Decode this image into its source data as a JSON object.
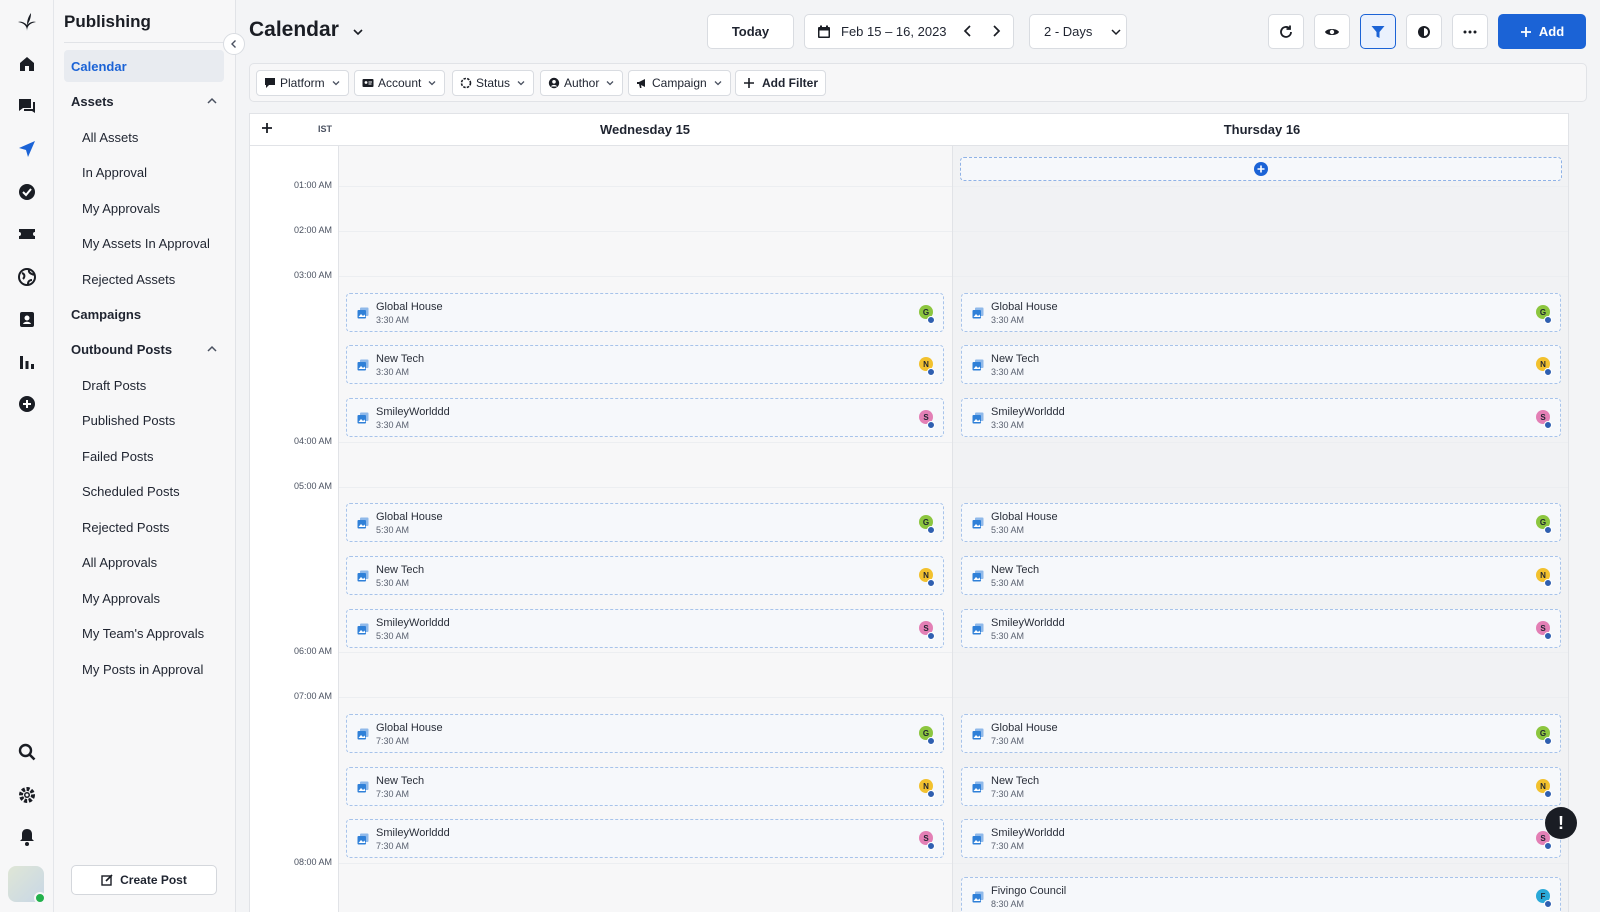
{
  "app": {
    "section_title": "Publishing"
  },
  "sidebar": {
    "items": [
      {
        "label": "Calendar"
      },
      {
        "label": "Assets"
      },
      {
        "label": "All Assets"
      },
      {
        "label": "In Approval"
      },
      {
        "label": "My Approvals"
      },
      {
        "label": "My Assets In Approval"
      },
      {
        "label": "Rejected Assets"
      },
      {
        "label": "Campaigns"
      },
      {
        "label": "Outbound Posts"
      },
      {
        "label": "Draft Posts"
      },
      {
        "label": "Published Posts"
      },
      {
        "label": "Failed Posts"
      },
      {
        "label": "Scheduled Posts"
      },
      {
        "label": "Rejected Posts"
      },
      {
        "label": "All Approvals"
      },
      {
        "label": "My Approvals"
      },
      {
        "label": "My Team's Approvals"
      },
      {
        "label": "My Posts in Approval"
      }
    ],
    "create_post_label": "Create Post"
  },
  "rail_icons": [
    "home-icon",
    "chat-icon",
    "send-icon",
    "check-circle-icon",
    "ticket-icon",
    "globe-icon",
    "contact-icon",
    "bar-chart-icon",
    "plus-circle-icon",
    "search-icon",
    "gear-icon",
    "bell-icon"
  ],
  "header": {
    "title": "Calendar",
    "today_label": "Today",
    "date_range": "Feb 15 – 16, 2023",
    "view_range": "2 - Days",
    "add_label": "Add"
  },
  "filters": {
    "platform": "Platform",
    "account": "Account",
    "status": "Status",
    "author": "Author",
    "campaign": "Campaign",
    "add_filter": "Add Filter"
  },
  "calendar": {
    "timezone": "IST",
    "days": [
      "Wednesday 15",
      "Thursday 16"
    ],
    "hours": [
      "01:00 AM",
      "02:00 AM",
      "03:00 AM",
      "04:00 AM",
      "05:00 AM",
      "06:00 AM",
      "07:00 AM",
      "08:00 AM"
    ],
    "events": {
      "wed": [
        {
          "name": "Global House",
          "time": "3:30 AM",
          "initial": "G",
          "color": "#8cc63f"
        },
        {
          "name": "New Tech",
          "time": "3:30 AM",
          "initial": "N",
          "color": "#f2c12e"
        },
        {
          "name": "SmileyWorlddd",
          "time": "3:30 AM",
          "initial": "S",
          "color": "#e37fb5"
        },
        {
          "name": "Global House",
          "time": "5:30 AM",
          "initial": "G",
          "color": "#8cc63f"
        },
        {
          "name": "New Tech",
          "time": "5:30 AM",
          "initial": "N",
          "color": "#f2c12e"
        },
        {
          "name": "SmileyWorlddd",
          "time": "5:30 AM",
          "initial": "S",
          "color": "#e37fb5"
        },
        {
          "name": "Global House",
          "time": "7:30 AM",
          "initial": "G",
          "color": "#8cc63f"
        },
        {
          "name": "New Tech",
          "time": "7:30 AM",
          "initial": "N",
          "color": "#f2c12e"
        },
        {
          "name": "SmileyWorlddd",
          "time": "7:30 AM",
          "initial": "S",
          "color": "#e37fb5"
        }
      ],
      "thu": [
        {
          "name": "Global House",
          "time": "3:30 AM",
          "initial": "G",
          "color": "#8cc63f"
        },
        {
          "name": "New Tech",
          "time": "3:30 AM",
          "initial": "N",
          "color": "#f2c12e"
        },
        {
          "name": "SmileyWorlddd",
          "time": "3:30 AM",
          "initial": "S",
          "color": "#e37fb5"
        },
        {
          "name": "Global House",
          "time": "5:30 AM",
          "initial": "G",
          "color": "#8cc63f"
        },
        {
          "name": "New Tech",
          "time": "5:30 AM",
          "initial": "N",
          "color": "#f2c12e"
        },
        {
          "name": "SmileyWorlddd",
          "time": "5:30 AM",
          "initial": "S",
          "color": "#e37fb5"
        },
        {
          "name": "Global House",
          "time": "7:30 AM",
          "initial": "G",
          "color": "#8cc63f"
        },
        {
          "name": "New Tech",
          "time": "7:30 AM",
          "initial": "N",
          "color": "#f2c12e"
        },
        {
          "name": "SmileyWorlddd",
          "time": "7:30 AM",
          "initial": "S",
          "color": "#e37fb5"
        },
        {
          "name": "Fivingo Council",
          "time": "8:30 AM",
          "initial": "F",
          "color": "#2aa9d8"
        }
      ]
    }
  },
  "colors": {
    "accent": "#1b63d6",
    "thursday_bg": "#f1f2f4"
  },
  "alert_label": "!"
}
